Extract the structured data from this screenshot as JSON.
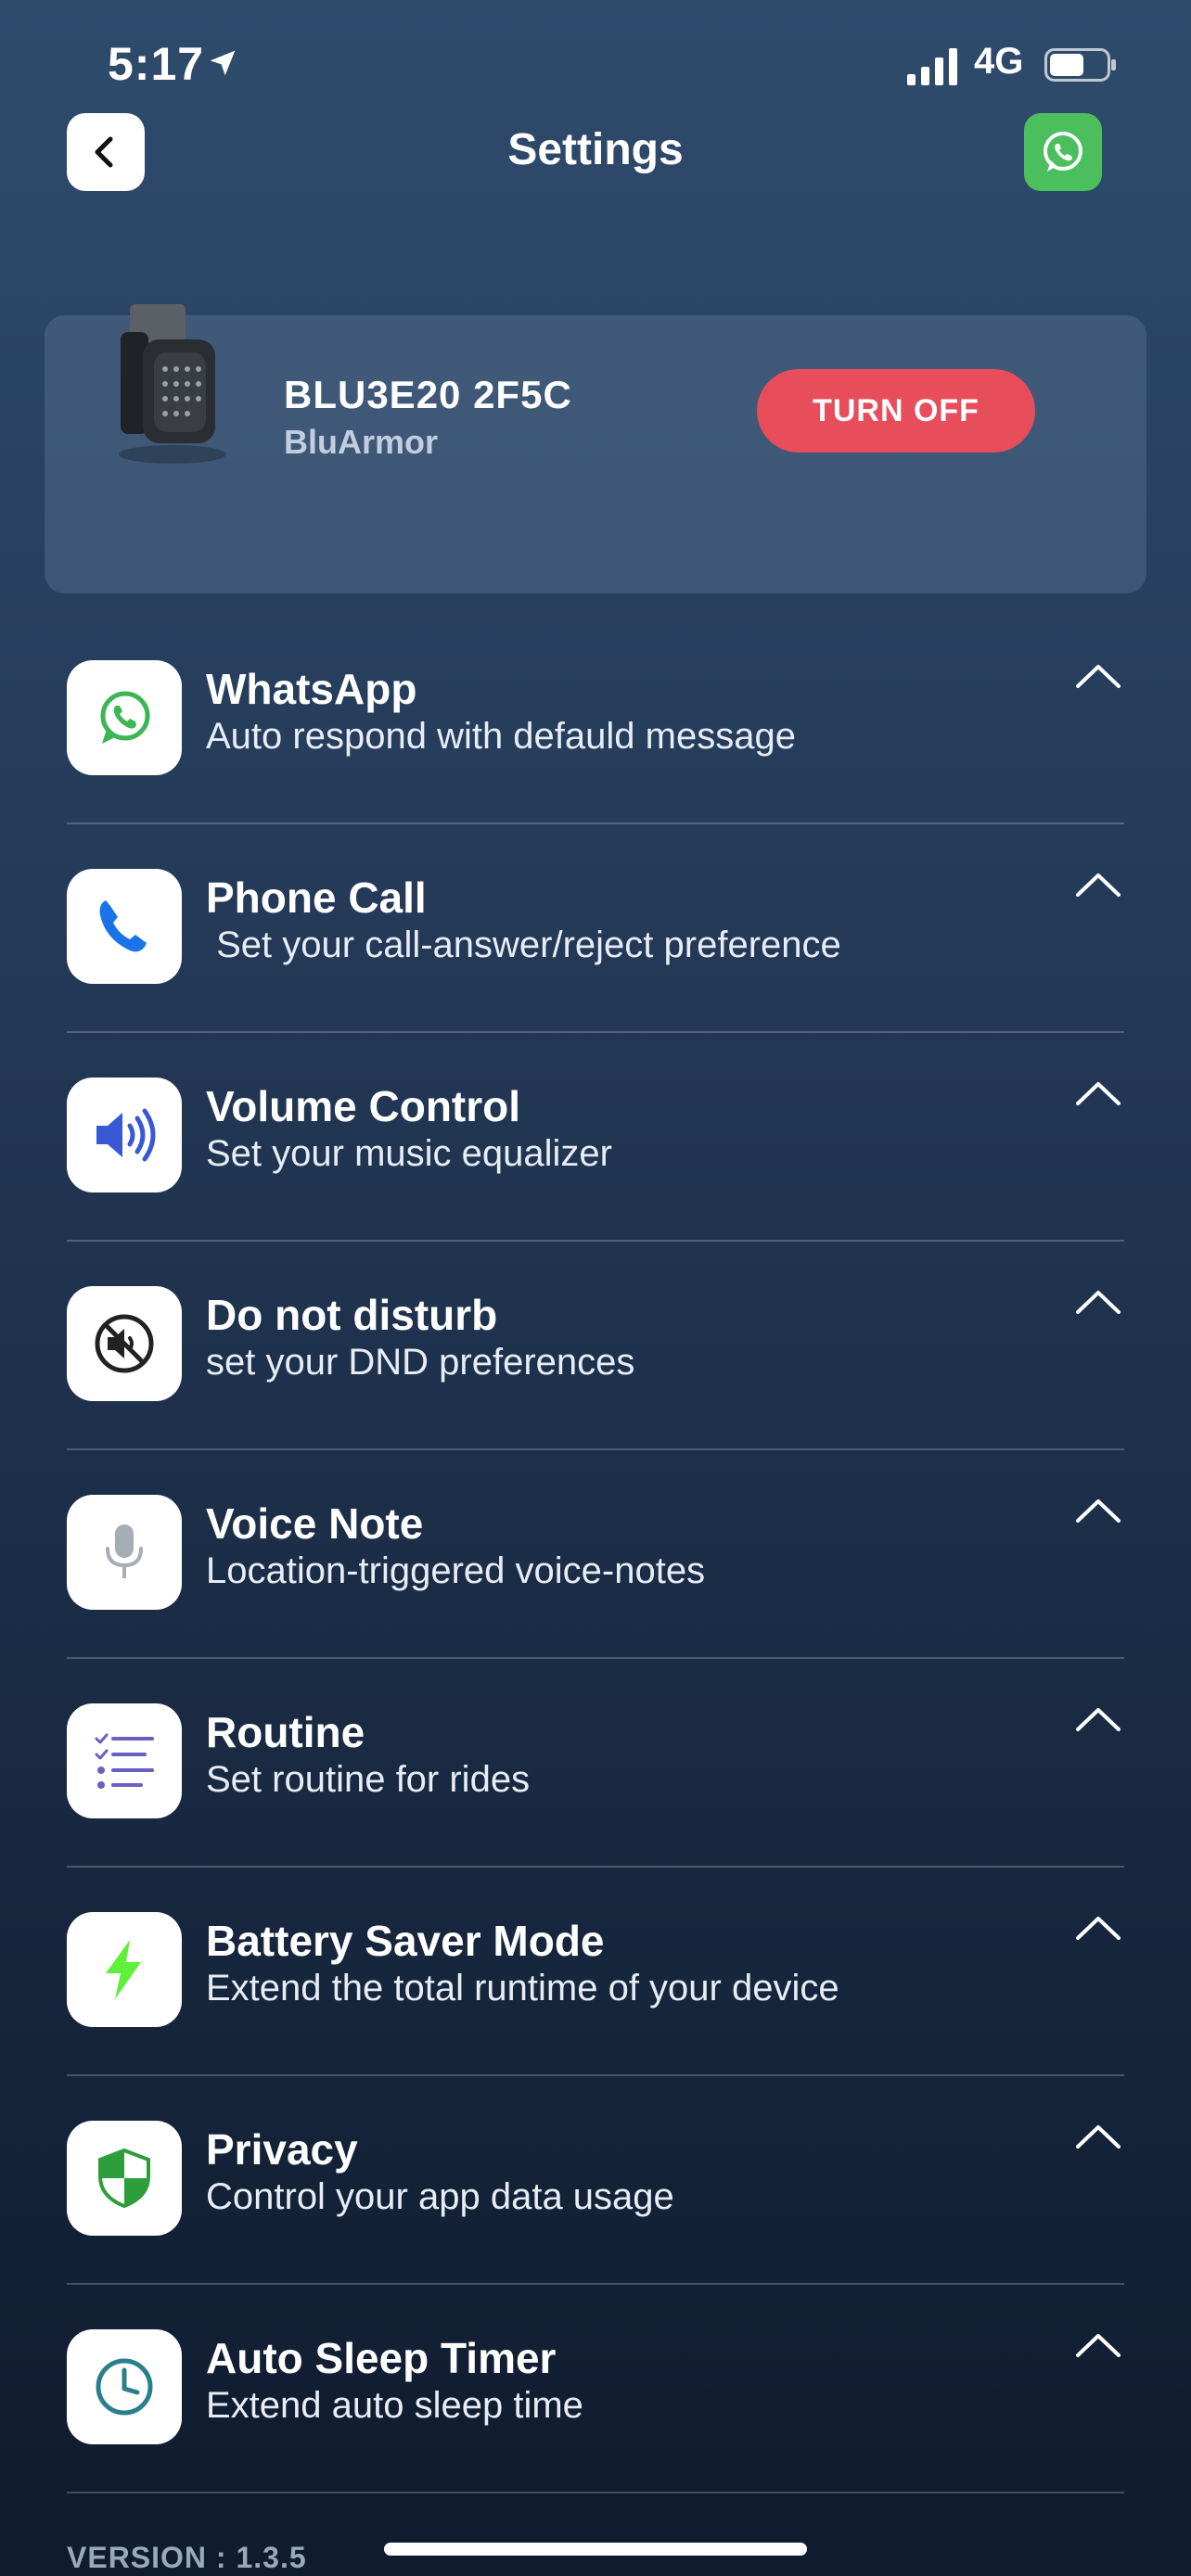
{
  "status_bar": {
    "time": "5:17",
    "network": "4G"
  },
  "header": {
    "title": "Settings"
  },
  "device": {
    "name": "BLU3E20 2F5C",
    "brand": "BluArmor",
    "action_label": "TURN OFF"
  },
  "settings": [
    {
      "title": "WhatsApp",
      "subtitle": "Auto respond with defauld message",
      "icon": "whatsapp-icon"
    },
    {
      "title": "Phone Call",
      "subtitle": " Set your call-answer/reject preference",
      "icon": "phone-icon"
    },
    {
      "title": "Volume Control",
      "subtitle": "Set your music equalizer",
      "icon": "speaker-icon"
    },
    {
      "title": "Do not disturb",
      "subtitle": "set your DND preferences",
      "icon": "mute-icon"
    },
    {
      "title": "Voice Note",
      "subtitle": "Location-triggered voice-notes",
      "icon": "microphone-icon"
    },
    {
      "title": "Routine",
      "subtitle": "Set routine for rides",
      "icon": "checklist-icon"
    },
    {
      "title": "Battery Saver Mode",
      "subtitle": "Extend the total runtime of your device",
      "icon": "lightning-icon"
    },
    {
      "title": "Privacy",
      "subtitle": "Control your app data usage",
      "icon": "shield-icon"
    },
    {
      "title": "Auto Sleep Timer",
      "subtitle": "Extend auto sleep time",
      "icon": "clock-icon"
    }
  ],
  "footer": {
    "version": "VERSION : 1.3.5"
  },
  "colors": {
    "accent_red": "#e84d5c",
    "whatsapp_green": "#4bbf5d",
    "phone_blue": "#1a73e8",
    "lightning_green": "#5ef03a",
    "shield_green": "#2e9e3c"
  }
}
